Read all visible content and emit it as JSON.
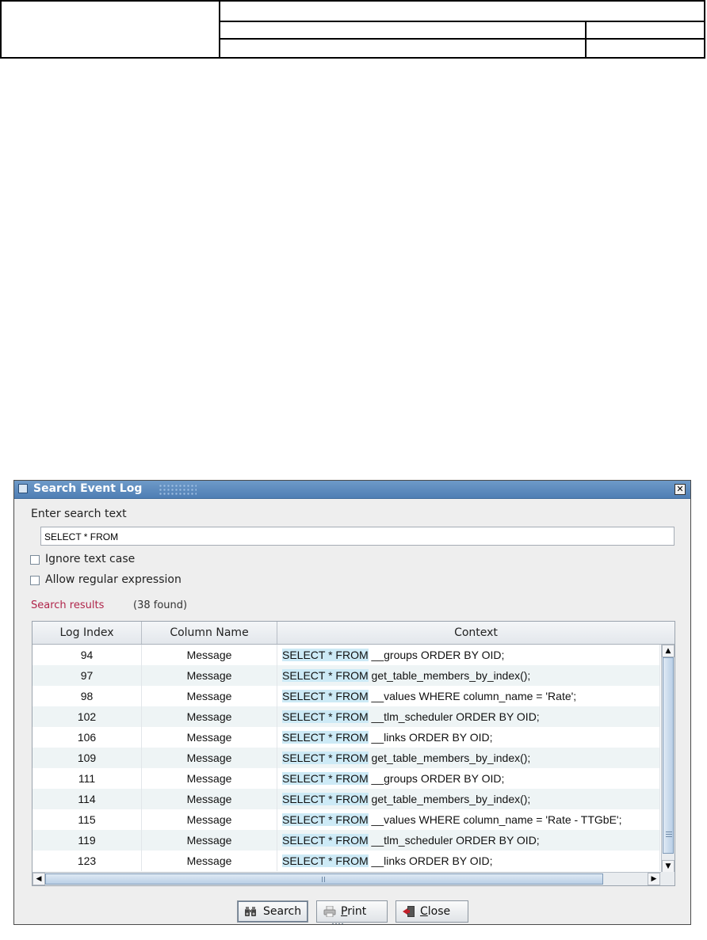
{
  "dialog": {
    "title": "Search Event Log",
    "search_label": "Enter search text",
    "search_value": "SELECT * FROM",
    "options": [
      {
        "label": "Ignore text case",
        "checked": false
      },
      {
        "label": "Allow regular expression",
        "checked": false
      }
    ],
    "results_title": "Search results",
    "results_count": "(38 found)",
    "table": {
      "columns": [
        "Log Index",
        "Column Name",
        "Context"
      ],
      "rows": [
        {
          "index": "94",
          "column": "Message",
          "match": "SELECT * FROM",
          "rest": " __groups ORDER BY OID;"
        },
        {
          "index": "97",
          "column": "Message",
          "match": "SELECT * FROM",
          "rest": " get_table_members_by_index();"
        },
        {
          "index": "98",
          "column": "Message",
          "match": "SELECT * FROM",
          "rest": " __values WHERE column_name = 'Rate';"
        },
        {
          "index": "102",
          "column": "Message",
          "match": "SELECT * FROM",
          "rest": " __tlm_scheduler ORDER BY OID;"
        },
        {
          "index": "106",
          "column": "Message",
          "match": "SELECT * FROM",
          "rest": " __links ORDER BY OID;"
        },
        {
          "index": "109",
          "column": "Message",
          "match": "SELECT * FROM",
          "rest": " get_table_members_by_index();"
        },
        {
          "index": "111",
          "column": "Message",
          "match": "SELECT * FROM",
          "rest": " __groups ORDER BY OID;"
        },
        {
          "index": "114",
          "column": "Message",
          "match": "SELECT * FROM",
          "rest": " get_table_members_by_index();"
        },
        {
          "index": "115",
          "column": "Message",
          "match": "SELECT * FROM",
          "rest": " __values WHERE column_name = 'Rate - TTGbE';"
        },
        {
          "index": "119",
          "column": "Message",
          "match": "SELECT * FROM",
          "rest": " __tlm_scheduler ORDER BY OID;"
        },
        {
          "index": "123",
          "column": "Message",
          "match": "SELECT * FROM",
          "rest": " __links ORDER BY OID;"
        }
      ]
    },
    "buttons": {
      "search": {
        "pre": "",
        "mnemonic": "",
        "post": "Search",
        "icon": "binoculars-icon"
      },
      "print": {
        "pre": "",
        "mnemonic": "P",
        "post": "rint",
        "icon": "printer-icon"
      },
      "close": {
        "pre": "",
        "mnemonic": "C",
        "post": "lose",
        "icon": "exit-door-icon"
      }
    },
    "colors": {
      "title_bar": "#5a88bd",
      "results_title": "#b0254a",
      "match_highlight": "#cdeaf6",
      "alt_row": "#eef4f5"
    }
  }
}
